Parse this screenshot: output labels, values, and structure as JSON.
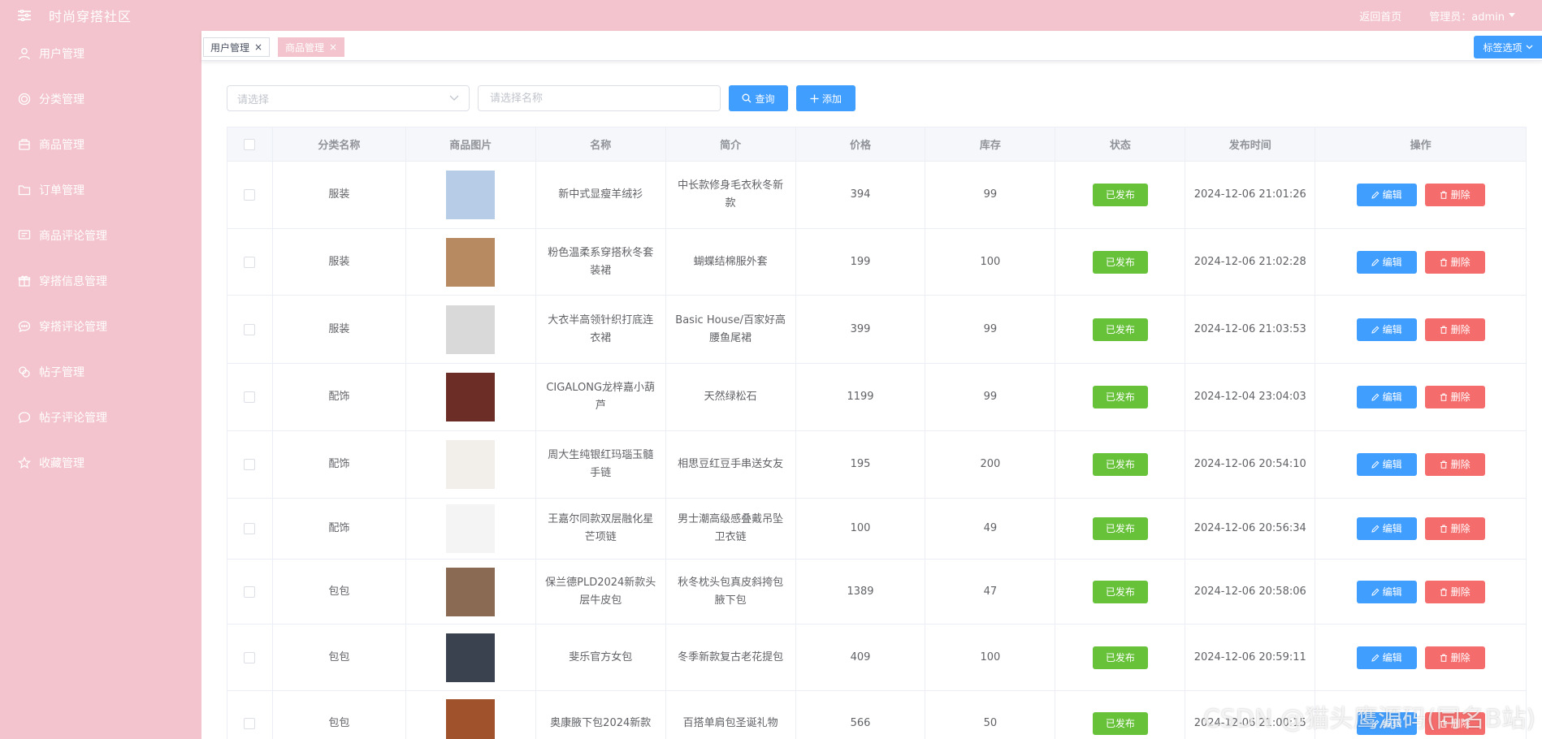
{
  "app": {
    "title": "时尚穿搭社区",
    "home_link": "返回首页",
    "admin_label": "管理员：admin"
  },
  "sidebar": {
    "items": [
      {
        "label": "用户管理",
        "icon": "user-icon"
      },
      {
        "label": "分类管理",
        "icon": "category-icon"
      },
      {
        "label": "商品管理",
        "icon": "product-icon"
      },
      {
        "label": "订单管理",
        "icon": "folder-icon"
      },
      {
        "label": "商品评论管理",
        "icon": "comment-icon"
      },
      {
        "label": "穿搭信息管理",
        "icon": "gift-icon"
      },
      {
        "label": "穿搭评论管理",
        "icon": "chat-icon"
      },
      {
        "label": "帖子管理",
        "icon": "post-icon"
      },
      {
        "label": "帖子评论管理",
        "icon": "bubble-icon"
      },
      {
        "label": "收藏管理",
        "icon": "star-icon"
      }
    ]
  },
  "tabs": [
    {
      "label": "用户管理",
      "active": false
    },
    {
      "label": "商品管理",
      "active": true
    }
  ],
  "tag_options_label": "标签选项",
  "filter": {
    "select_placeholder": "请选择",
    "name_placeholder": "请选择名称",
    "query_label": "查询",
    "add_label": "添加"
  },
  "table": {
    "headers": [
      "分类名称",
      "商品图片",
      "名称",
      "简介",
      "价格",
      "库存",
      "状态",
      "发布时间",
      "操作"
    ],
    "edit_label": "编辑",
    "delete_label": "删除",
    "rows": [
      {
        "category": "服装",
        "name": "新中式显瘦羊绒衫",
        "desc": "中长款修身毛衣秋冬新款",
        "price": "394",
        "stock": "99",
        "status": "已发布",
        "time": "2024-12-06 21:01:26",
        "thumb_color": "#b7cce6"
      },
      {
        "category": "服装",
        "name": "粉色温柔系穿搭秋冬套装裙",
        "desc": "蝴蝶结棉服外套",
        "price": "199",
        "stock": "100",
        "status": "已发布",
        "time": "2024-12-06 21:02:28",
        "thumb_color": "#b78a62"
      },
      {
        "category": "服装",
        "name": "大衣半高领针织打底连衣裙",
        "desc": "Basic House/百家好高腰鱼尾裙",
        "price": "399",
        "stock": "99",
        "status": "已发布",
        "time": "2024-12-06 21:03:53",
        "thumb_color": "#d9d9d9"
      },
      {
        "category": "配饰",
        "name": "CIGALONG龙梓嘉小葫芦",
        "desc": "天然绿松石",
        "price": "1199",
        "stock": "99",
        "status": "已发布",
        "time": "2024-12-04 23:04:03",
        "thumb_color": "#6b2d26"
      },
      {
        "category": "配饰",
        "name": "周大生纯银红玛瑙玉髓手链",
        "desc": "相思豆红豆手串送女友",
        "price": "195",
        "stock": "200",
        "status": "已发布",
        "time": "2024-12-06 20:54:10",
        "thumb_color": "#f2eeea"
      },
      {
        "category": "配饰",
        "name": "王嘉尔同款双层融化星芒项链",
        "desc": "男士潮高级感叠戴吊坠卫衣链",
        "price": "100",
        "stock": "49",
        "status": "已发布",
        "time": "2024-12-06 20:56:34",
        "thumb_color": "#f4f4f4"
      },
      {
        "category": "包包",
        "name": "保兰德PLD2024新款头层牛皮包",
        "desc": "秋冬枕头包真皮斜挎包腋下包",
        "price": "1389",
        "stock": "47",
        "status": "已发布",
        "time": "2024-12-06 20:58:06",
        "thumb_color": "#8a6a52"
      },
      {
        "category": "包包",
        "name": "斐乐官方女包",
        "desc": "冬季新款复古老花提包",
        "price": "409",
        "stock": "100",
        "status": "已发布",
        "time": "2024-12-06 20:59:11",
        "thumb_color": "#3a4250"
      },
      {
        "category": "包包",
        "name": "奥康腋下包2024新款",
        "desc": "百搭单肩包圣诞礼物",
        "price": "566",
        "stock": "50",
        "status": "已发布",
        "time": "2024-12-06 21:00:15",
        "thumb_color": "#a0522d"
      }
    ]
  },
  "watermark": "CSDN @猫头鹰源码(同名B站)"
}
